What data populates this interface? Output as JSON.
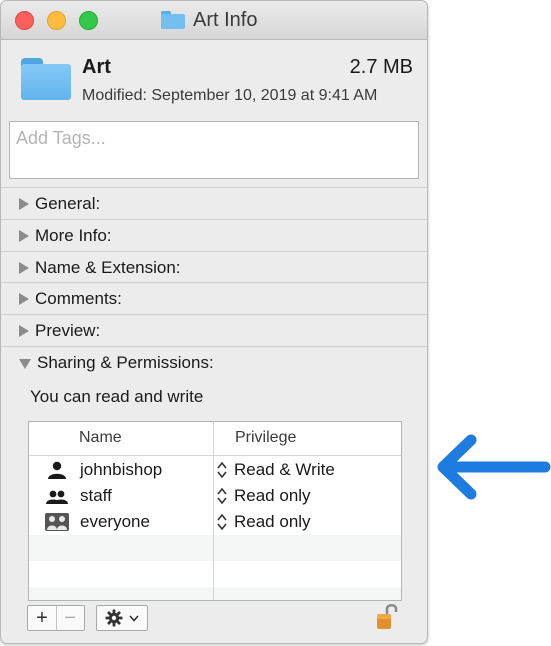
{
  "window": {
    "title": "Art Info",
    "accent_color": "#1e7be0"
  },
  "header": {
    "name": "Art",
    "size": "2.7 MB",
    "modified": "Modified: September 10, 2019 at 9:41 AM",
    "icon": "folder-icon"
  },
  "tags": {
    "placeholder": "Add Tags..."
  },
  "sections": [
    {
      "label": "General:",
      "expanded": false
    },
    {
      "label": "More Info:",
      "expanded": false
    },
    {
      "label": "Name & Extension:",
      "expanded": false
    },
    {
      "label": "Comments:",
      "expanded": false
    },
    {
      "label": "Preview:",
      "expanded": false
    },
    {
      "label": "Sharing & Permissions:",
      "expanded": true
    }
  ],
  "permissions": {
    "summary": "You can read and write",
    "columns": [
      "Name",
      "Privilege"
    ],
    "rows": [
      {
        "name": "johnbishop",
        "privilege": "Read & Write",
        "icon": "user-icon"
      },
      {
        "name": "staff",
        "privilege": "Read only",
        "icon": "group-icon"
      },
      {
        "name": "everyone",
        "privilege": "Read only",
        "icon": "everyone-icon"
      }
    ]
  },
  "toolbar": {
    "add_label": "+",
    "remove_label": "−",
    "action_icon": "gear-icon",
    "lock_icon": "lock-open-icon"
  },
  "annotation": {
    "icon": "arrow-left-icon",
    "color": "#1e7be0"
  }
}
